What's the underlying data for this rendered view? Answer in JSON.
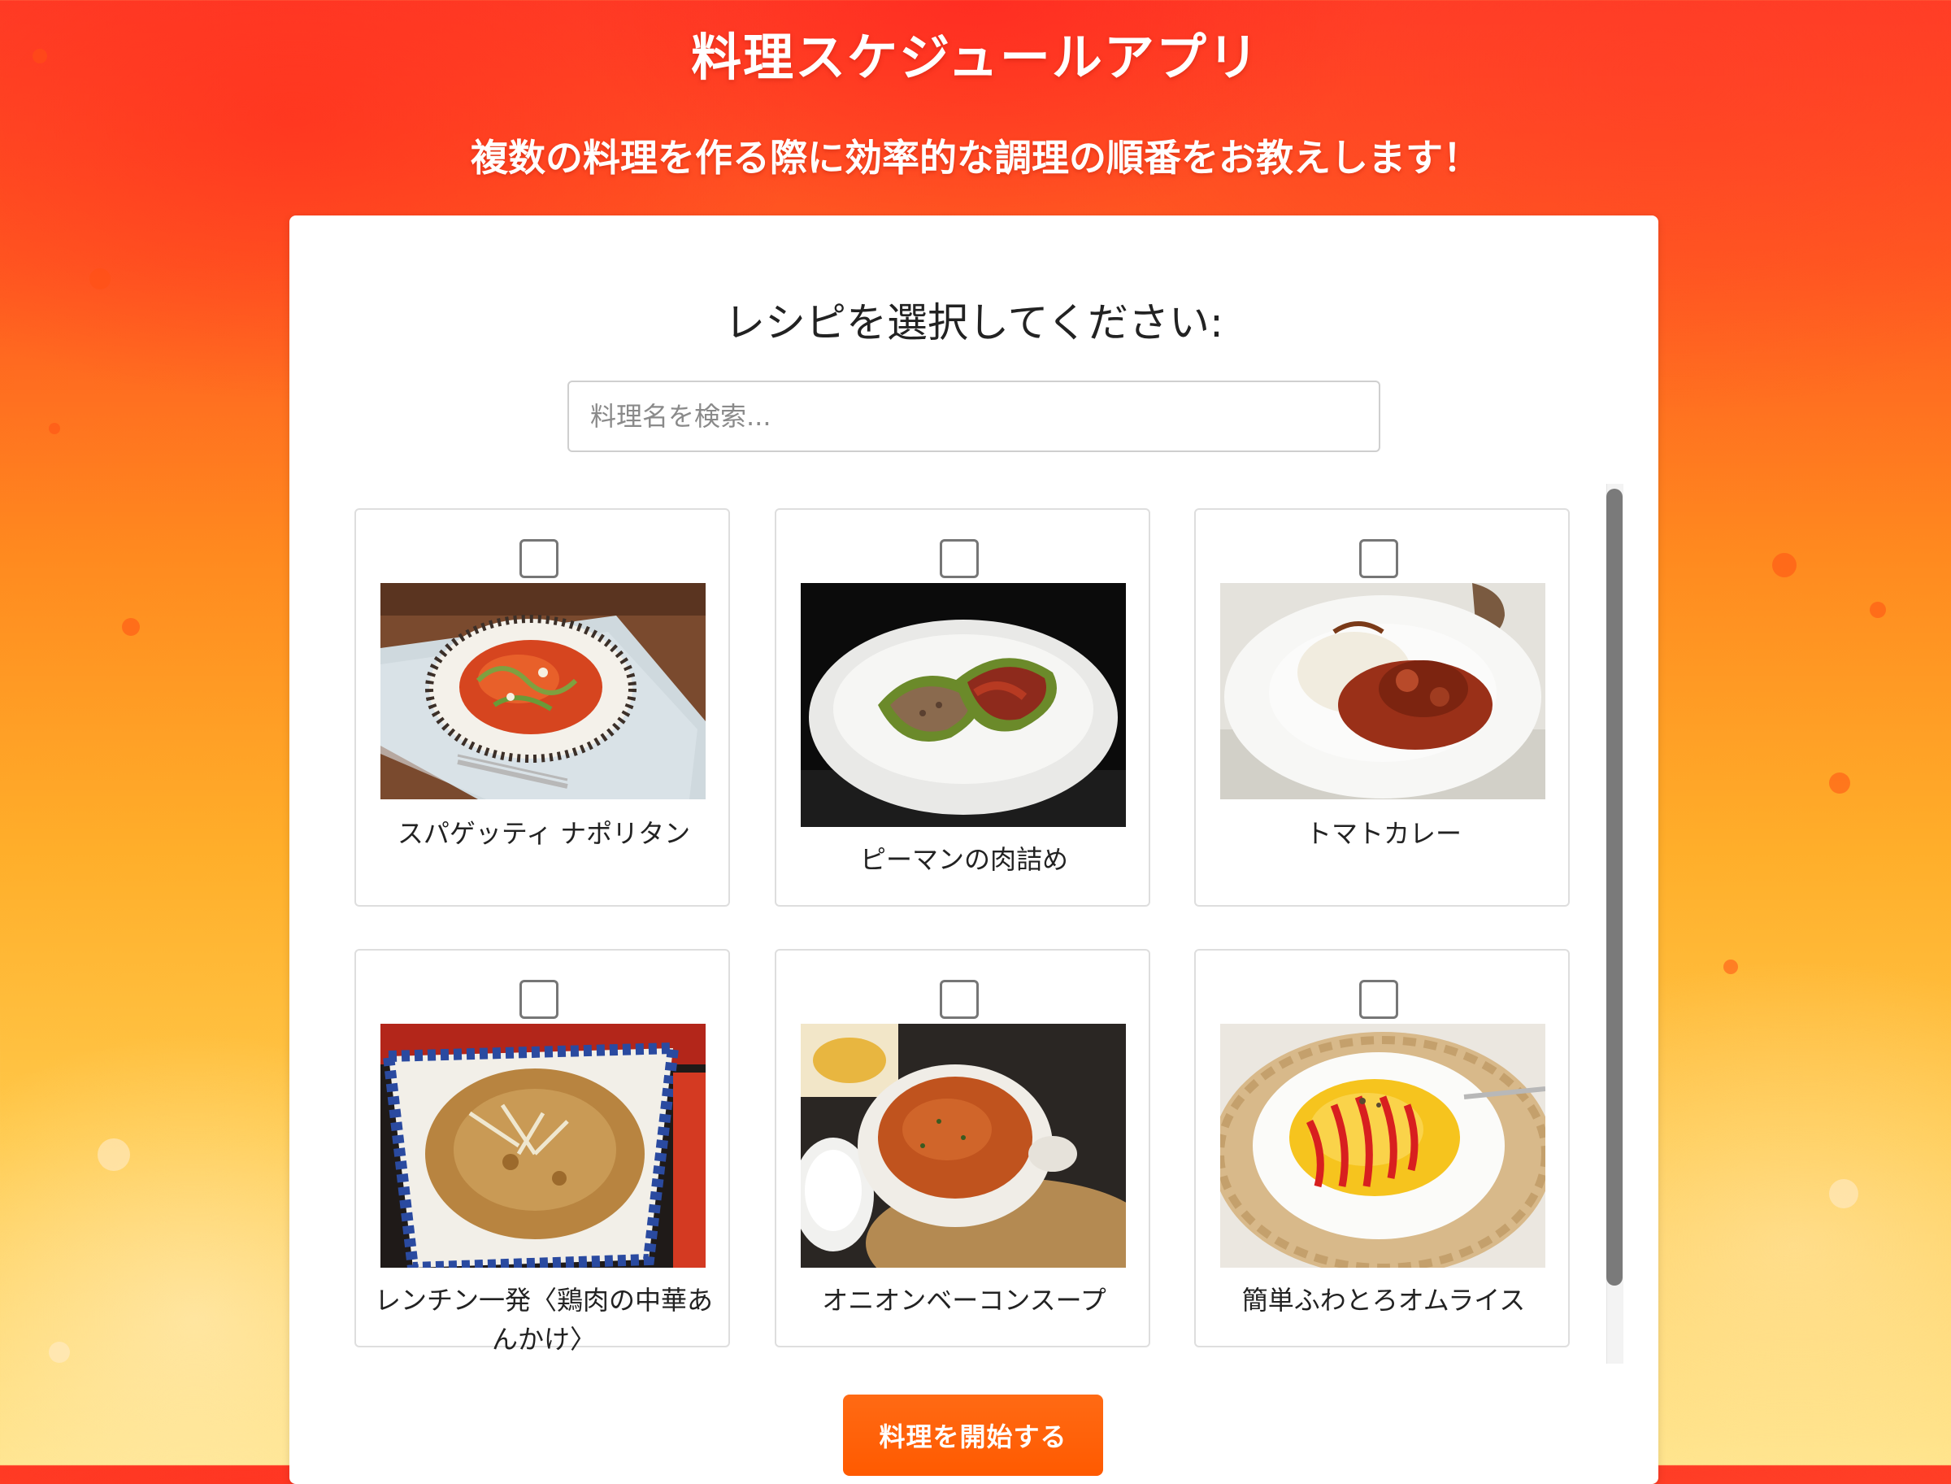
{
  "header": {
    "title": "料理スケジュールアプリ",
    "subtitle": "複数の料理を作る際に効率的な調理の順番をお教えします！"
  },
  "main": {
    "prompt": "レシピを選択してください:",
    "search_placeholder": "料理名を検索...",
    "recipes": [
      {
        "label": "スパゲッティ ナポリタン",
        "checked": false
      },
      {
        "label": "ピーマンの肉詰め",
        "checked": false
      },
      {
        "label": "トマトカレー",
        "checked": false
      },
      {
        "label": "レンチン一発〈鶏肉の中華あんかけ〉",
        "checked": false
      },
      {
        "label": "オニオンベーコンスープ",
        "checked": false
      },
      {
        "label": "簡単ふわとろオムライス",
        "checked": false
      }
    ],
    "start_button": "料理を開始する"
  },
  "colors": {
    "accent": "#ff5a00",
    "header_top": "#ff3d25",
    "header_bottom": "#ffe48a"
  }
}
